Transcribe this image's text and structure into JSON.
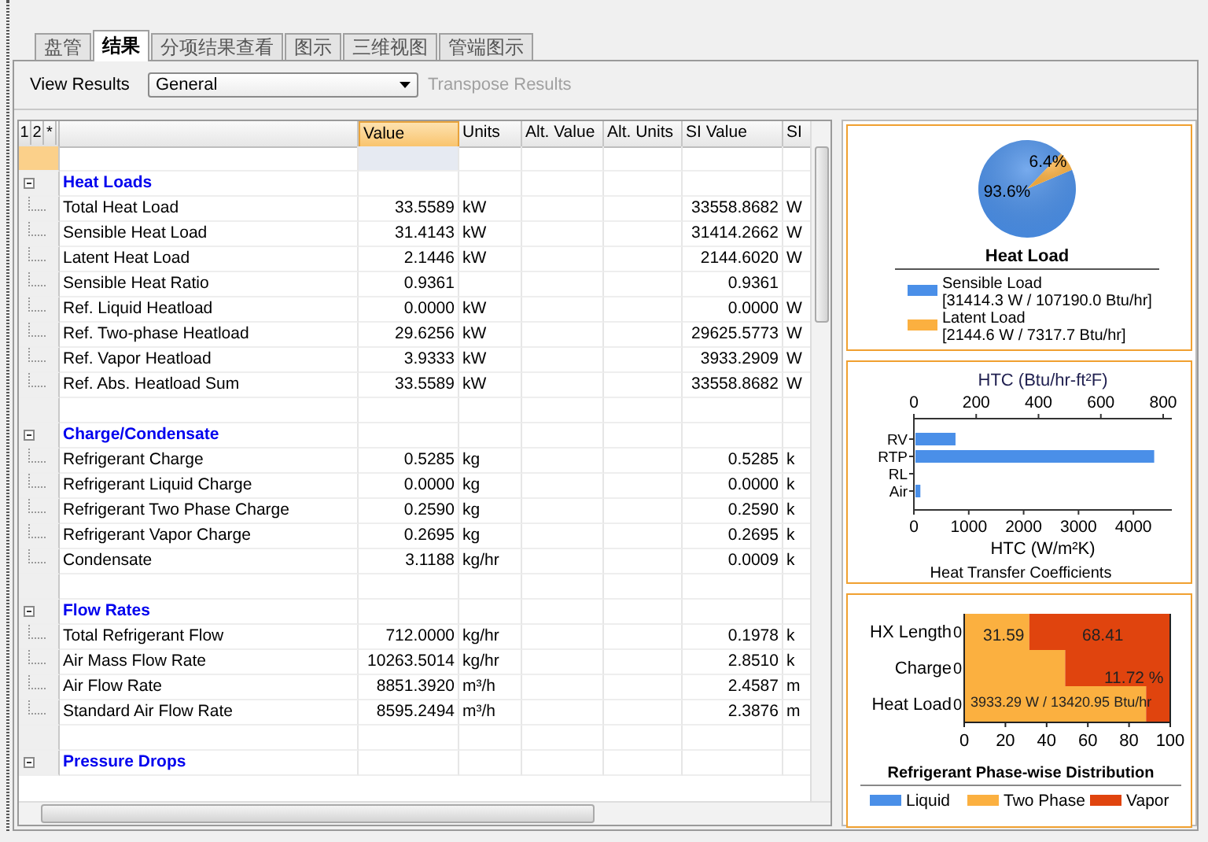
{
  "tabs": [
    {
      "label": "盘管",
      "selected": false
    },
    {
      "label": "结果",
      "selected": true
    },
    {
      "label": "分项结果查看",
      "selected": false
    },
    {
      "label": "图示",
      "selected": false
    },
    {
      "label": "三维视图",
      "selected": false
    },
    {
      "label": "管端图示",
      "selected": false
    }
  ],
  "toolbar": {
    "view_label": "View Results",
    "view_value": "General",
    "transpose": {
      "label": "Transpose Results",
      "disabled": true
    }
  },
  "table": {
    "level_buttons": [
      "1",
      "2",
      "*"
    ],
    "columns": [
      {
        "label": "Value",
        "selected": true
      },
      {
        "label": "Units",
        "selected": false
      },
      {
        "label": "Alt. Value",
        "selected": false
      },
      {
        "label": "Alt. Units",
        "selected": false
      },
      {
        "label": "SI Value",
        "selected": false
      },
      {
        "label": "SI",
        "selected": false
      }
    ],
    "rows": [
      {
        "kind": "blank",
        "selected": true
      },
      {
        "kind": "group",
        "label": "Heat Loads",
        "expanded": true,
        "selected": false
      },
      {
        "kind": "item",
        "label": "Total Heat Load",
        "value": "33.5589",
        "units": "kW",
        "si_value": "33558.8682",
        "column_7": "W",
        "selected": false
      },
      {
        "kind": "item",
        "label": "Sensible Heat Load",
        "value": "31.4143",
        "units": "kW",
        "si_value": "31414.2662",
        "column_7": "W",
        "selected": false
      },
      {
        "kind": "item",
        "label": "Latent Heat Load",
        "value": "2.1446",
        "units": "kW",
        "si_value": "2144.6020",
        "column_7": "W",
        "selected": false
      },
      {
        "kind": "item",
        "label": "Sensible Heat Ratio",
        "value": "0.9361",
        "si_value": "0.9361",
        "selected": false
      },
      {
        "kind": "item",
        "label": "Ref. Liquid Heatload",
        "value": "0.0000",
        "units": "kW",
        "si_value": "0.0000",
        "column_7": "W",
        "selected": false
      },
      {
        "kind": "item",
        "label": "Ref. Two-phase Heatload",
        "value": "29.6256",
        "units": "kW",
        "si_value": "29625.5773",
        "column_7": "W",
        "selected": false
      },
      {
        "kind": "item",
        "label": "Ref. Vapor Heatload",
        "value": "3.9333",
        "units": "kW",
        "si_value": "3933.2909",
        "column_7": "W",
        "selected": false
      },
      {
        "kind": "item",
        "label": "Ref. Abs. Heatload Sum",
        "value": "33.5589",
        "units": "kW",
        "si_value": "33558.8682",
        "column_7": "W",
        "selected": false
      },
      {
        "kind": "blank",
        "selected": false
      },
      {
        "kind": "group",
        "label": "Charge/Condensate",
        "expanded": true,
        "selected": false
      },
      {
        "kind": "item",
        "label": "Refrigerant Charge",
        "value": "0.5285",
        "units": "kg",
        "si_value": "0.5285",
        "column_7": "k",
        "selected": false
      },
      {
        "kind": "item",
        "label": "Refrigerant Liquid Charge",
        "value": "0.0000",
        "units": "kg",
        "si_value": "0.0000",
        "column_7": "k",
        "selected": false
      },
      {
        "kind": "item",
        "label": "Refrigerant Two Phase Charge",
        "value": "0.2590",
        "units": "kg",
        "si_value": "0.2590",
        "column_7": "k",
        "selected": false
      },
      {
        "kind": "item",
        "label": "Refrigerant Vapor Charge",
        "value": "0.2695",
        "units": "kg",
        "si_value": "0.2695",
        "column_7": "k",
        "selected": false
      },
      {
        "kind": "item",
        "label": "Condensate",
        "value": "3.1188",
        "units": "kg/hr",
        "si_value": "0.0009",
        "column_7": "k",
        "selected": false
      },
      {
        "kind": "blank",
        "selected": false
      },
      {
        "kind": "group",
        "label": "Flow Rates",
        "expanded": true,
        "selected": false
      },
      {
        "kind": "item",
        "label": "Total Refrigerant Flow",
        "value": "712.0000",
        "units": "kg/hr",
        "si_value": "0.1978",
        "column_7": "k",
        "selected": false
      },
      {
        "kind": "item",
        "label": "Air Mass Flow Rate",
        "value": "10263.5014",
        "units": "kg/hr",
        "si_value": "2.8510",
        "column_7": "k",
        "selected": false
      },
      {
        "kind": "item",
        "label": "Air Flow Rate",
        "value": "8851.3920",
        "units": "m³/h",
        "si_value": "2.4587",
        "column_7": "m",
        "selected": false
      },
      {
        "kind": "item",
        "label": "Standard Air Flow Rate",
        "value": "8595.2494",
        "units": "m³/h",
        "si_value": "2.3876",
        "column_7": "m",
        "selected": false
      },
      {
        "kind": "blank",
        "selected": false
      },
      {
        "kind": "group",
        "label": "Pressure Drops",
        "expanded": true,
        "selected": false
      }
    ]
  },
  "heat_load": {
    "legend_items": [
      {
        "detail": "[31414.3 W / 107190.0 Btu/hr]",
        "color": "#4a8fe8"
      },
      {
        "detail": "[2144.6 W / 7317.7 Btu/hr]",
        "color": "#fbb040"
      }
    ],
    "chart_data": {
      "type": "pie",
      "title": "Heat Load",
      "categories": [
        "Sensible Load",
        "Latent Load"
      ],
      "values": [
        93.6,
        6.4
      ],
      "value_labels": [
        "93.6%",
        "6.4%"
      ],
      "legend": true
    }
  },
  "htc": {
    "secondary_axis": {
      "label": "HTC (Btu/hr-ft²F)",
      "ticks": [
        "0",
        "200",
        "400",
        "600",
        "800"
      ]
    },
    "chart_data": {
      "type": "bar",
      "orientation": "horizontal",
      "title": "Heat Transfer Coefficients",
      "xlabel": "HTC (W/m²K)",
      "categories": [
        "RV",
        "RTP",
        "RL",
        "Air"
      ],
      "values": [
        730,
        4350,
        0,
        90
      ],
      "xlim": [
        0,
        4700
      ],
      "xticks": [
        0,
        1000,
        2000,
        3000,
        4000
      ]
    }
  },
  "phase": {
    "chart_data": {
      "type": "bar",
      "orientation": "horizontal",
      "stacked": true,
      "title": "Refrigerant Phase-wise Distribution",
      "categories": [
        "HX Length",
        "Charge",
        "Heat Load"
      ],
      "series": [
        {
          "name": "Liquid",
          "color": "#4a8fe8",
          "values": [
            0,
            0,
            0
          ]
        },
        {
          "name": "Two Phase",
          "color": "#fbb040",
          "values": [
            31.59,
            49,
            88.28
          ]
        },
        {
          "name": "Vapor",
          "color": "#e0440e",
          "values": [
            68.41,
            51,
            11.72
          ]
        }
      ],
      "xlim": [
        0,
        100
      ],
      "xticks": [
        0,
        20,
        40,
        60,
        80,
        100
      ],
      "value_labels": [
        "0",
        "0",
        "0"
      ],
      "legend": true,
      "annotations": [
        "31.59",
        "68.41",
        "11.72 %",
        "3933.29 W / 13420.95 Btu/hr"
      ]
    }
  }
}
